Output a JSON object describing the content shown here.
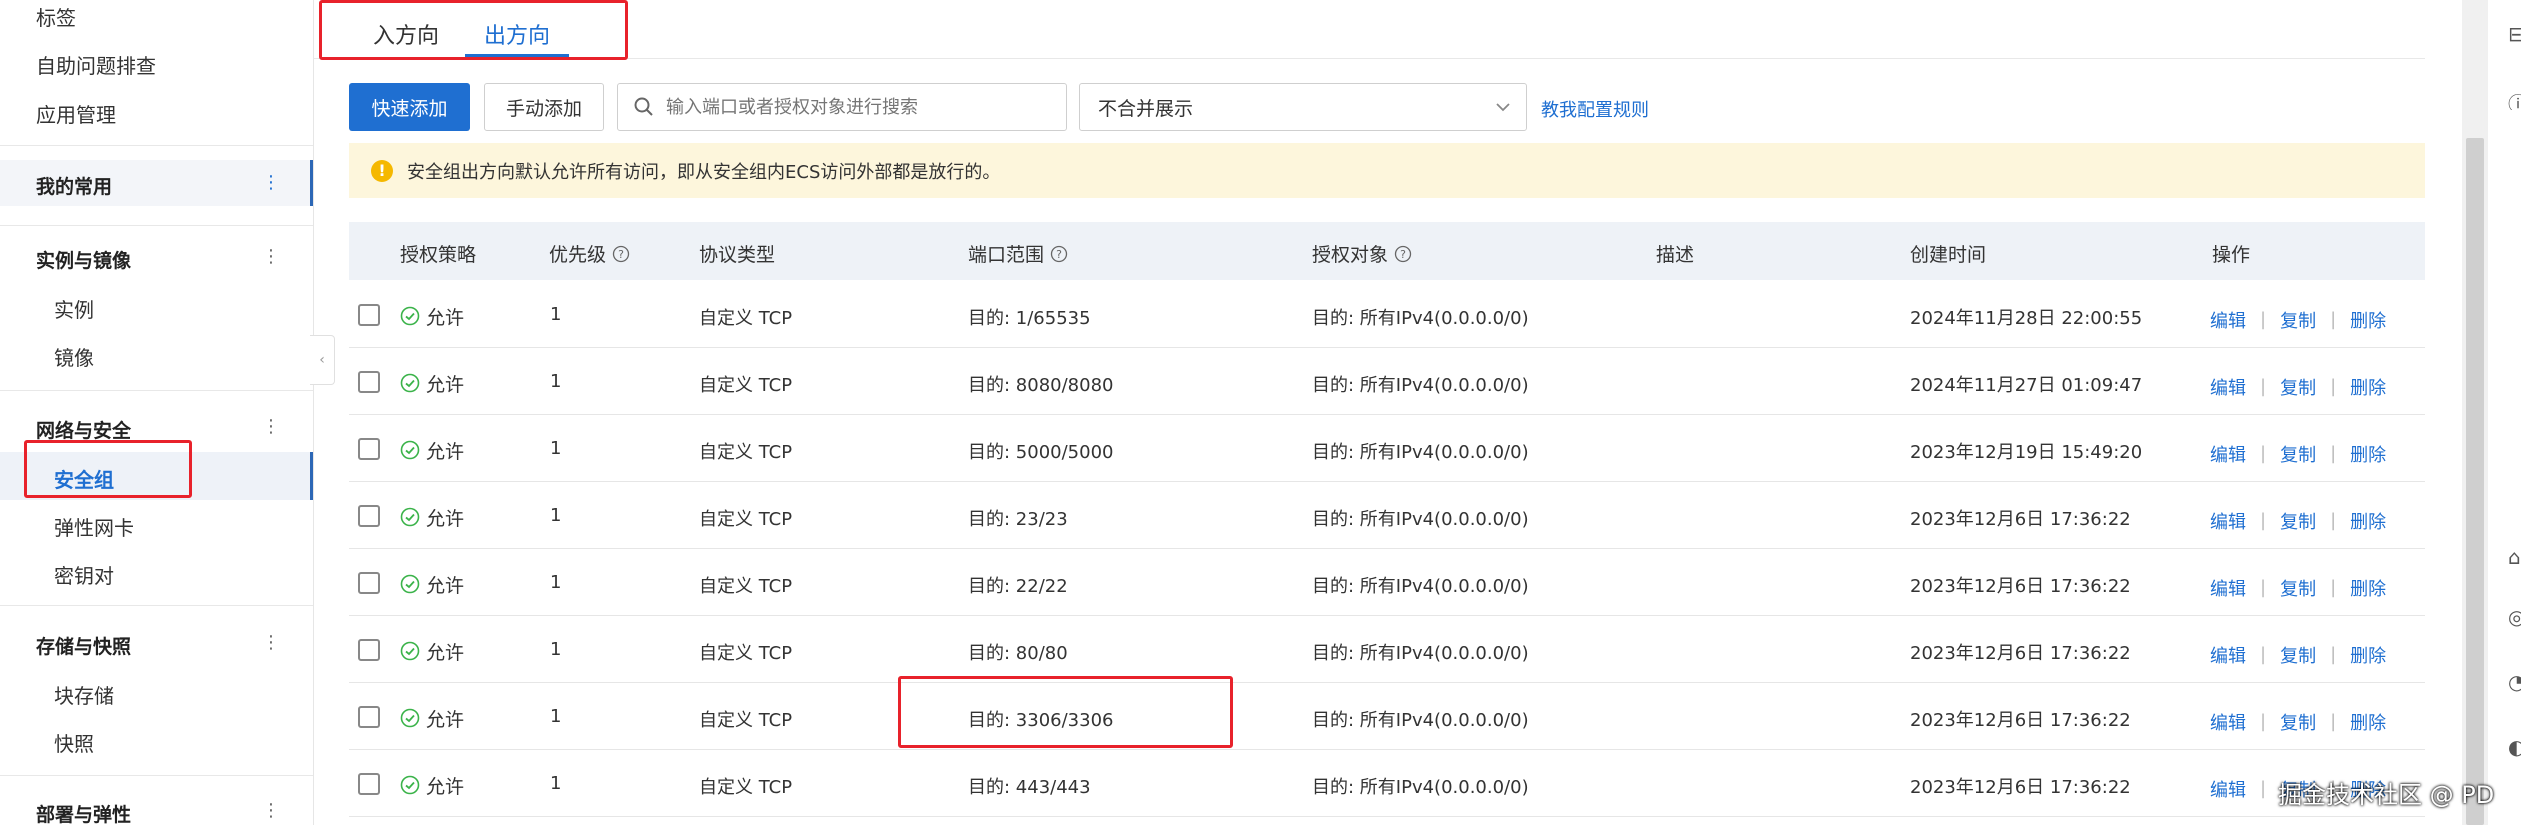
{
  "sidebar": {
    "items_top": [
      "标签",
      "自助问题排查",
      "应用管理"
    ],
    "favorites_label": "我的常用",
    "groups": [
      {
        "title": "实例与镜像",
        "items": [
          "实例",
          "镜像"
        ]
      },
      {
        "title": "网络与安全",
        "items": [
          "安全组",
          "弹性网卡",
          "密钥对"
        ]
      },
      {
        "title": "存储与快照",
        "items": [
          "块存储",
          "快照"
        ]
      },
      {
        "title": "部署与弹性",
        "items": []
      }
    ],
    "more_glyph": "⋮",
    "collapse_glyph": "‹"
  },
  "tabs": [
    {
      "label": "入方向",
      "active": false
    },
    {
      "label": "出方向",
      "active": true
    }
  ],
  "toolbar": {
    "quick_add": "快速添加",
    "manual_add": "手动添加",
    "search_placeholder": "输入端口或者授权对象进行搜索",
    "merge_select_value": "不合并展示",
    "help_link": "教我配置规则"
  },
  "notice": {
    "icon": "!",
    "text": "安全组出方向默认允许所有访问，即从安全组内ECS访问外部都是放行的。"
  },
  "table": {
    "headers": {
      "policy": "授权策略",
      "priority": "优先级",
      "protocol": "协议类型",
      "port": "端口范围",
      "target": "授权对象",
      "desc": "描述",
      "created": "创建时间",
      "actions": "操作"
    },
    "rows": [
      {
        "policy": "允许",
        "priority": "1",
        "protocol": "自定义 TCP",
        "port": "目的: 1/65535",
        "target": "目的: 所有IPv4(0.0.0.0/0)",
        "desc": "",
        "created": "2024年11月28日 22:00:55"
      },
      {
        "policy": "允许",
        "priority": "1",
        "protocol": "自定义 TCP",
        "port": "目的: 8080/8080",
        "target": "目的: 所有IPv4(0.0.0.0/0)",
        "desc": "",
        "created": "2024年11月27日 01:09:47"
      },
      {
        "policy": "允许",
        "priority": "1",
        "protocol": "自定义 TCP",
        "port": "目的: 5000/5000",
        "target": "目的: 所有IPv4(0.0.0.0/0)",
        "desc": "",
        "created": "2023年12月19日 15:49:20"
      },
      {
        "policy": "允许",
        "priority": "1",
        "protocol": "自定义 TCP",
        "port": "目的: 23/23",
        "target": "目的: 所有IPv4(0.0.0.0/0)",
        "desc": "",
        "created": "2023年12月6日 17:36:22"
      },
      {
        "policy": "允许",
        "priority": "1",
        "protocol": "自定义 TCP",
        "port": "目的: 22/22",
        "target": "目的: 所有IPv4(0.0.0.0/0)",
        "desc": "",
        "created": "2023年12月6日 17:36:22"
      },
      {
        "policy": "允许",
        "priority": "1",
        "protocol": "自定义 TCP",
        "port": "目的: 80/80",
        "target": "目的: 所有IPv4(0.0.0.0/0)",
        "desc": "",
        "created": "2023年12月6日 17:36:22"
      },
      {
        "policy": "允许",
        "priority": "1",
        "protocol": "自定义 TCP",
        "port": "目的: 3306/3306",
        "target": "目的: 所有IPv4(0.0.0.0/0)",
        "desc": "",
        "created": "2023年12月6日 17:36:22"
      },
      {
        "policy": "允许",
        "priority": "1",
        "protocol": "自定义 TCP",
        "port": "目的: 443/443",
        "target": "目的: 所有IPv4(0.0.0.0/0)",
        "desc": "",
        "created": "2023年12月6日 17:36:22"
      }
    ],
    "actions": {
      "edit": "编辑",
      "copy": "复制",
      "delete": "删除",
      "sep": "|"
    }
  },
  "watermark": "掘金技术社区 @ PD",
  "colors": {
    "primary": "#1f6fd1",
    "highlight": "#e8222b",
    "notice_bg": "#fdf6dc",
    "success": "#3bb34a"
  }
}
